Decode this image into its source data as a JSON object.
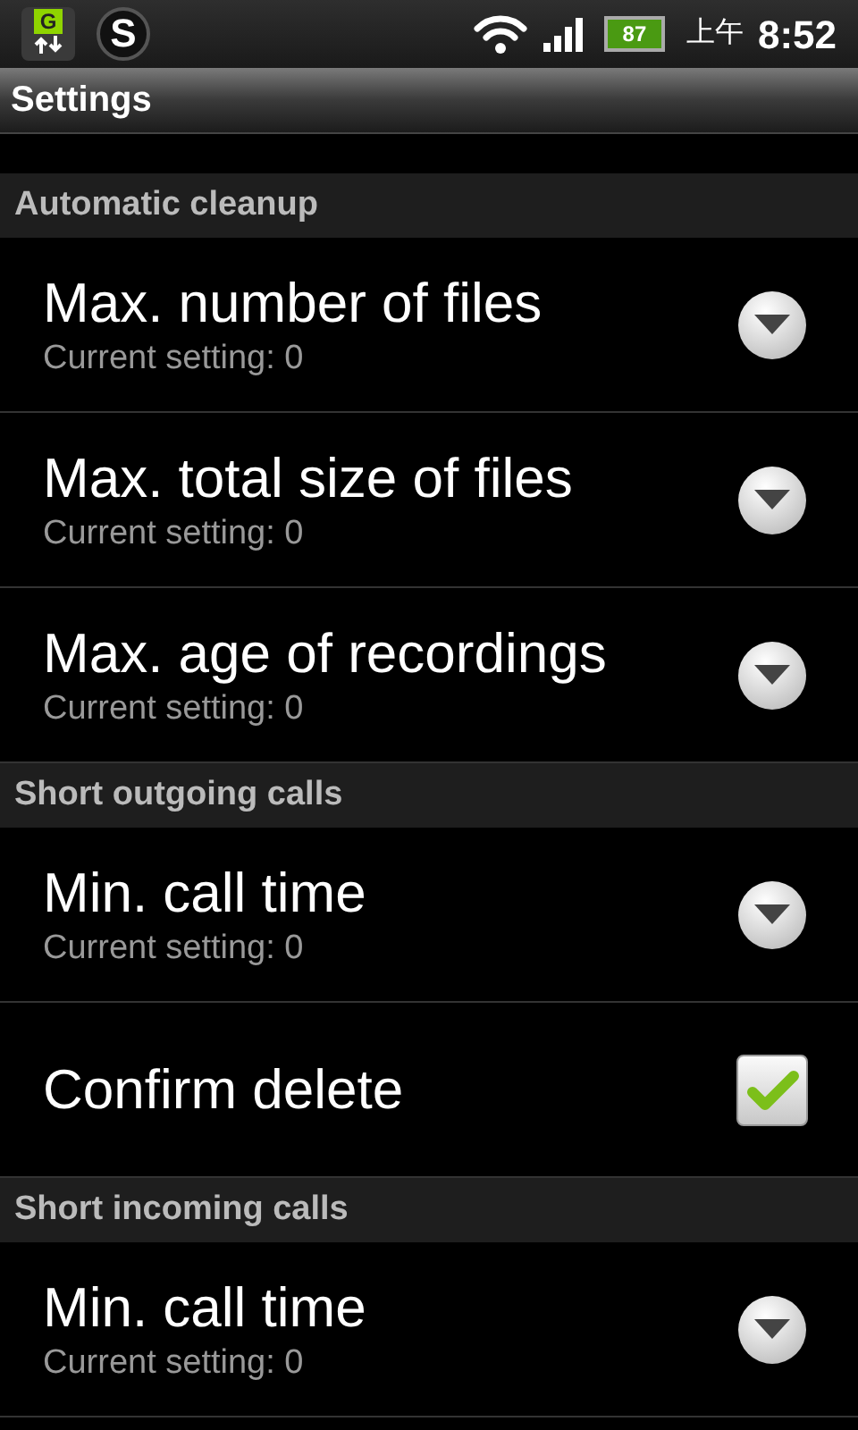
{
  "status_bar": {
    "notifications": [
      {
        "kind": "sync",
        "letter": "G"
      },
      {
        "kind": "chat",
        "letter": "S"
      }
    ],
    "battery": "87",
    "am_pm": "上午",
    "time": "8:52"
  },
  "title": "Settings",
  "sections": [
    {
      "header": "Automatic cleanup",
      "items": [
        {
          "kind": "list",
          "title": "Max. number of files",
          "summary": "Current setting: 0"
        },
        {
          "kind": "list",
          "title": "Max. total size of files",
          "summary": "Current setting: 0"
        },
        {
          "kind": "list",
          "title": "Max. age of recordings",
          "summary": "Current setting: 0"
        }
      ]
    },
    {
      "header": "Short outgoing calls",
      "items": [
        {
          "kind": "list",
          "title": "Min. call time",
          "summary": "Current setting: 0"
        },
        {
          "kind": "checkbox",
          "title": "Confirm delete",
          "checked": true
        }
      ]
    },
    {
      "header": "Short incoming calls",
      "items": [
        {
          "kind": "list",
          "title": "Min. call time",
          "summary": "Current setting: 0"
        }
      ]
    }
  ]
}
